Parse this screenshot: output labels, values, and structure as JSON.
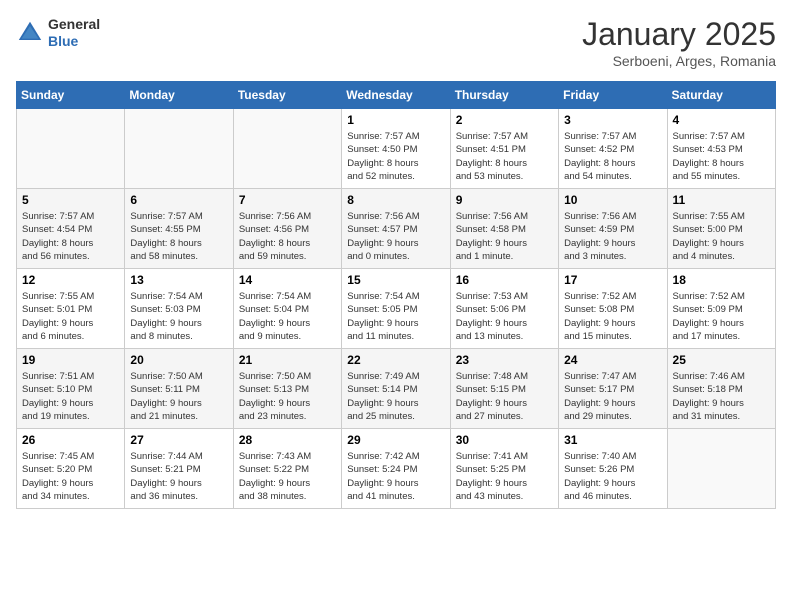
{
  "header": {
    "logo_line1": "General",
    "logo_line2": "Blue",
    "title": "January 2025",
    "subtitle": "Serboeni, Arges, Romania"
  },
  "weekdays": [
    "Sunday",
    "Monday",
    "Tuesday",
    "Wednesday",
    "Thursday",
    "Friday",
    "Saturday"
  ],
  "weeks": [
    [
      {
        "day": "",
        "info": ""
      },
      {
        "day": "",
        "info": ""
      },
      {
        "day": "",
        "info": ""
      },
      {
        "day": "1",
        "info": "Sunrise: 7:57 AM\nSunset: 4:50 PM\nDaylight: 8 hours\nand 52 minutes."
      },
      {
        "day": "2",
        "info": "Sunrise: 7:57 AM\nSunset: 4:51 PM\nDaylight: 8 hours\nand 53 minutes."
      },
      {
        "day": "3",
        "info": "Sunrise: 7:57 AM\nSunset: 4:52 PM\nDaylight: 8 hours\nand 54 minutes."
      },
      {
        "day": "4",
        "info": "Sunrise: 7:57 AM\nSunset: 4:53 PM\nDaylight: 8 hours\nand 55 minutes."
      }
    ],
    [
      {
        "day": "5",
        "info": "Sunrise: 7:57 AM\nSunset: 4:54 PM\nDaylight: 8 hours\nand 56 minutes."
      },
      {
        "day": "6",
        "info": "Sunrise: 7:57 AM\nSunset: 4:55 PM\nDaylight: 8 hours\nand 58 minutes."
      },
      {
        "day": "7",
        "info": "Sunrise: 7:56 AM\nSunset: 4:56 PM\nDaylight: 8 hours\nand 59 minutes."
      },
      {
        "day": "8",
        "info": "Sunrise: 7:56 AM\nSunset: 4:57 PM\nDaylight: 9 hours\nand 0 minutes."
      },
      {
        "day": "9",
        "info": "Sunrise: 7:56 AM\nSunset: 4:58 PM\nDaylight: 9 hours\nand 1 minute."
      },
      {
        "day": "10",
        "info": "Sunrise: 7:56 AM\nSunset: 4:59 PM\nDaylight: 9 hours\nand 3 minutes."
      },
      {
        "day": "11",
        "info": "Sunrise: 7:55 AM\nSunset: 5:00 PM\nDaylight: 9 hours\nand 4 minutes."
      }
    ],
    [
      {
        "day": "12",
        "info": "Sunrise: 7:55 AM\nSunset: 5:01 PM\nDaylight: 9 hours\nand 6 minutes."
      },
      {
        "day": "13",
        "info": "Sunrise: 7:54 AM\nSunset: 5:03 PM\nDaylight: 9 hours\nand 8 minutes."
      },
      {
        "day": "14",
        "info": "Sunrise: 7:54 AM\nSunset: 5:04 PM\nDaylight: 9 hours\nand 9 minutes."
      },
      {
        "day": "15",
        "info": "Sunrise: 7:54 AM\nSunset: 5:05 PM\nDaylight: 9 hours\nand 11 minutes."
      },
      {
        "day": "16",
        "info": "Sunrise: 7:53 AM\nSunset: 5:06 PM\nDaylight: 9 hours\nand 13 minutes."
      },
      {
        "day": "17",
        "info": "Sunrise: 7:52 AM\nSunset: 5:08 PM\nDaylight: 9 hours\nand 15 minutes."
      },
      {
        "day": "18",
        "info": "Sunrise: 7:52 AM\nSunset: 5:09 PM\nDaylight: 9 hours\nand 17 minutes."
      }
    ],
    [
      {
        "day": "19",
        "info": "Sunrise: 7:51 AM\nSunset: 5:10 PM\nDaylight: 9 hours\nand 19 minutes."
      },
      {
        "day": "20",
        "info": "Sunrise: 7:50 AM\nSunset: 5:11 PM\nDaylight: 9 hours\nand 21 minutes."
      },
      {
        "day": "21",
        "info": "Sunrise: 7:50 AM\nSunset: 5:13 PM\nDaylight: 9 hours\nand 23 minutes."
      },
      {
        "day": "22",
        "info": "Sunrise: 7:49 AM\nSunset: 5:14 PM\nDaylight: 9 hours\nand 25 minutes."
      },
      {
        "day": "23",
        "info": "Sunrise: 7:48 AM\nSunset: 5:15 PM\nDaylight: 9 hours\nand 27 minutes."
      },
      {
        "day": "24",
        "info": "Sunrise: 7:47 AM\nSunset: 5:17 PM\nDaylight: 9 hours\nand 29 minutes."
      },
      {
        "day": "25",
        "info": "Sunrise: 7:46 AM\nSunset: 5:18 PM\nDaylight: 9 hours\nand 31 minutes."
      }
    ],
    [
      {
        "day": "26",
        "info": "Sunrise: 7:45 AM\nSunset: 5:20 PM\nDaylight: 9 hours\nand 34 minutes."
      },
      {
        "day": "27",
        "info": "Sunrise: 7:44 AM\nSunset: 5:21 PM\nDaylight: 9 hours\nand 36 minutes."
      },
      {
        "day": "28",
        "info": "Sunrise: 7:43 AM\nSunset: 5:22 PM\nDaylight: 9 hours\nand 38 minutes."
      },
      {
        "day": "29",
        "info": "Sunrise: 7:42 AM\nSunset: 5:24 PM\nDaylight: 9 hours\nand 41 minutes."
      },
      {
        "day": "30",
        "info": "Sunrise: 7:41 AM\nSunset: 5:25 PM\nDaylight: 9 hours\nand 43 minutes."
      },
      {
        "day": "31",
        "info": "Sunrise: 7:40 AM\nSunset: 5:26 PM\nDaylight: 9 hours\nand 46 minutes."
      },
      {
        "day": "",
        "info": ""
      }
    ]
  ]
}
